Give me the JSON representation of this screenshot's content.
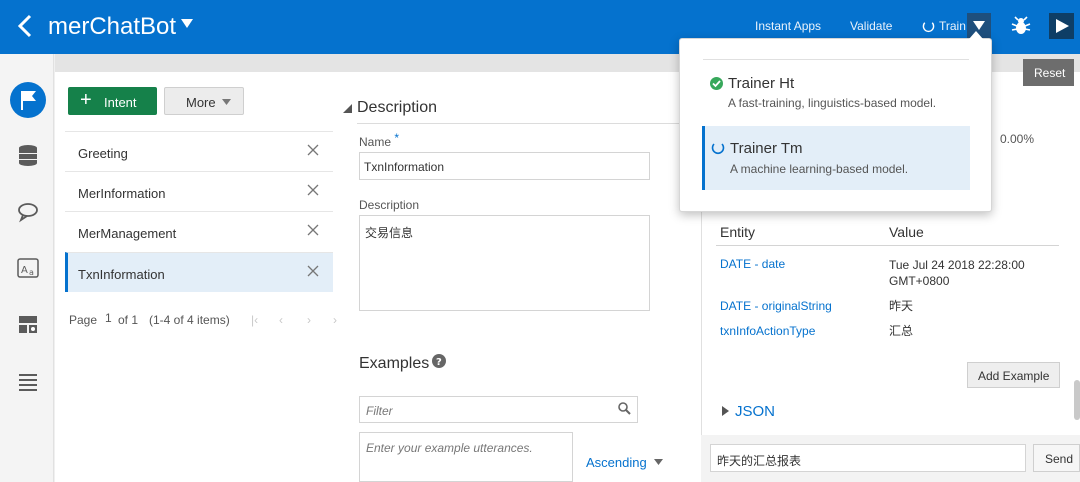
{
  "header": {
    "bot_name": "merChatBot",
    "links": {
      "instant_apps": "Instant Apps",
      "validate": "Validate",
      "train": "Train"
    },
    "accent": "#0572ce"
  },
  "nav": {
    "icons": [
      "intents-flag-icon",
      "entities-db-icon",
      "flows-chat-icon",
      "resource-bundles-icon",
      "settings-icon",
      "insights-list-icon"
    ]
  },
  "intents": {
    "add_label": "Intent",
    "more_label": "More",
    "items": [
      {
        "name": "Greeting"
      },
      {
        "name": "MerInformation"
      },
      {
        "name": "MerManagement"
      },
      {
        "name": "TxnInformation",
        "selected": true
      }
    ],
    "pager": {
      "page_label": "Page",
      "page_value": "1",
      "of_label": "of 1",
      "count_label": "(1-4 of 4 items)"
    }
  },
  "description_panel": {
    "heading": "Description",
    "name_label": "Name",
    "required_mark": "*",
    "name_value": "TxnInformation",
    "desc_label": "Description",
    "desc_value": "交易信息",
    "examples_heading": "Examples",
    "filter_placeholder": "Filter",
    "utterance_placeholder": "Enter your example utterances.",
    "sort_label": "Ascending"
  },
  "tester": {
    "reset_label": "Reset",
    "percent": "0.00%",
    "entity_header": "Entity",
    "value_header": "Value",
    "entities": [
      {
        "entity": "DATE - date",
        "value1": "Tue Jul 24 2018 22:28:00",
        "value2": "GMT+0800"
      },
      {
        "entity": "DATE - originalString",
        "value1": "昨天",
        "value2": ""
      },
      {
        "entity": "txnInfoActionType",
        "value1": "汇总",
        "value2": ""
      }
    ],
    "add_example_label": "Add Example",
    "json_label": "JSON",
    "chat_input_value": "昨天的汇总报表",
    "send_label": "Send"
  },
  "train_menu": {
    "options": [
      {
        "title": "Trainer Ht",
        "desc": "A fast-training, linguistics-based model.",
        "status": "trained"
      },
      {
        "title": "Trainer Tm",
        "desc": "A machine learning-based model.",
        "status": "training",
        "selected": true
      }
    ]
  }
}
